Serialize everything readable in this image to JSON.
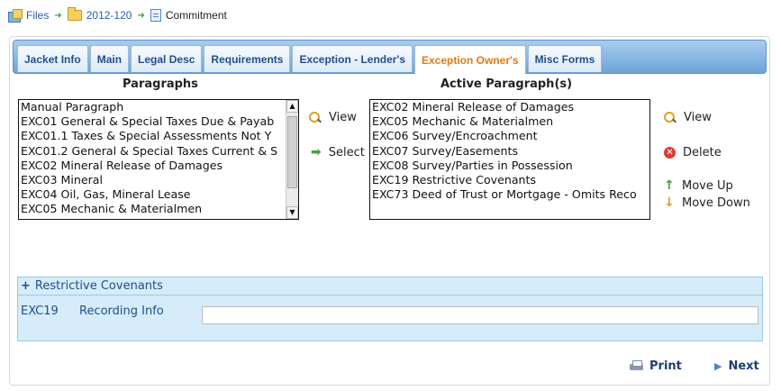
{
  "breadcrumb": {
    "files": "Files",
    "folder": "2012-120",
    "current": "Commitment"
  },
  "tabs": [
    {
      "label": "Jacket Info",
      "active": false
    },
    {
      "label": "Main",
      "active": false
    },
    {
      "label": "Legal Desc",
      "active": false
    },
    {
      "label": "Requirements",
      "active": false
    },
    {
      "label": "Exception - Lender's",
      "active": false
    },
    {
      "label": "Exception Owner's",
      "active": true
    },
    {
      "label": "Misc Forms",
      "active": false
    }
  ],
  "paragraphs": {
    "title": "Paragraphs",
    "items": [
      "Manual Paragraph",
      "EXC01 General & Special Taxes Due & Payab",
      "EXC01.1 Taxes & Special Assessments Not Y",
      "EXC01.2 General & Special Taxes Current & S",
      "EXC02 Mineral Release of Damages",
      "EXC03 Mineral",
      "EXC04 Oil, Gas, Mineral Lease",
      "EXC05 Mechanic & Materialmen"
    ]
  },
  "middle_actions": {
    "view_label": "View",
    "select_label": "Select"
  },
  "active_paragraphs": {
    "title": "Active Paragraph(s)",
    "items": [
      "EXC02 Mineral Release of Damages",
      "EXC05 Mechanic & Materialmen",
      "EXC06 Survey/Encroachment",
      "EXC07 Survey/Easements",
      "EXC08 Survey/Parties in Possession",
      "EXC19 Restrictive Covenants",
      "EXC73 Deed of Trust or Mortgage - Omits Reco"
    ]
  },
  "right_actions": {
    "view_label": "View",
    "delete_label": "Delete",
    "move_up_label": "Move Up",
    "move_down_label": "Move Down"
  },
  "covenants": {
    "header": "Restrictive Covenants",
    "plus": "+",
    "code": "EXC19",
    "field_label": "Recording Info",
    "field_value": ""
  },
  "footer": {
    "print_label": "Print",
    "next_label": "Next"
  },
  "colors": {
    "tab_active_text": "#e37a10",
    "tab_text": "#1f4f8f",
    "tabbar_blue": "#6ba4d9",
    "section_bg": "#d6ecfa"
  }
}
